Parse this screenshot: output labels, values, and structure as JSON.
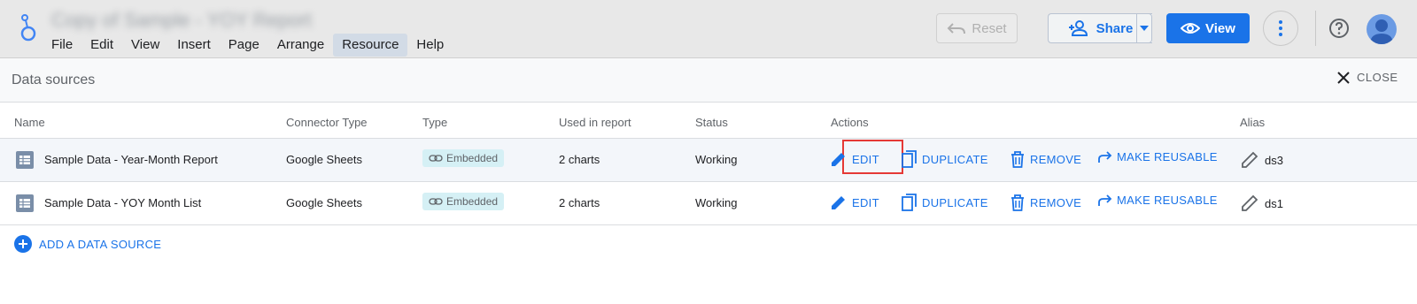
{
  "app": {
    "document_title": "Copy of Sample - YOY Report"
  },
  "menu": [
    {
      "label": "File"
    },
    {
      "label": "Edit"
    },
    {
      "label": "View"
    },
    {
      "label": "Insert"
    },
    {
      "label": "Page"
    },
    {
      "label": "Arrange"
    },
    {
      "label": "Resource",
      "active": true
    },
    {
      "label": "Help"
    }
  ],
  "toolbar": {
    "reset_label": "Reset",
    "share_label": "Share",
    "view_label": "View"
  },
  "panel": {
    "title": "Data sources",
    "close_label": "CLOSE"
  },
  "table": {
    "headers": {
      "name": "Name",
      "connector_type": "Connector Type",
      "type": "Type",
      "used_in_report": "Used in report",
      "status": "Status",
      "actions": "Actions",
      "alias": "Alias"
    },
    "rows": [
      {
        "name": "Sample Data - Year-Month Report",
        "connector_type": "Google Sheets",
        "type": "Embedded",
        "used_in_report": "2 charts",
        "status": "Working",
        "alias": "ds3"
      },
      {
        "name": "Sample Data - YOY Month List",
        "connector_type": "Google Sheets",
        "type": "Embedded",
        "used_in_report": "2 charts",
        "status": "Working",
        "alias": "ds1"
      }
    ],
    "actions": {
      "edit": "EDIT",
      "duplicate": "DUPLICATE",
      "remove": "REMOVE",
      "make_reusable": "MAKE REUSABLE"
    }
  },
  "add_data_source_label": "ADD A DATA SOURCE",
  "colors": {
    "accent": "#1a73e8",
    "highlight": "#e53935",
    "badge_bg": "#d5f0f5"
  }
}
